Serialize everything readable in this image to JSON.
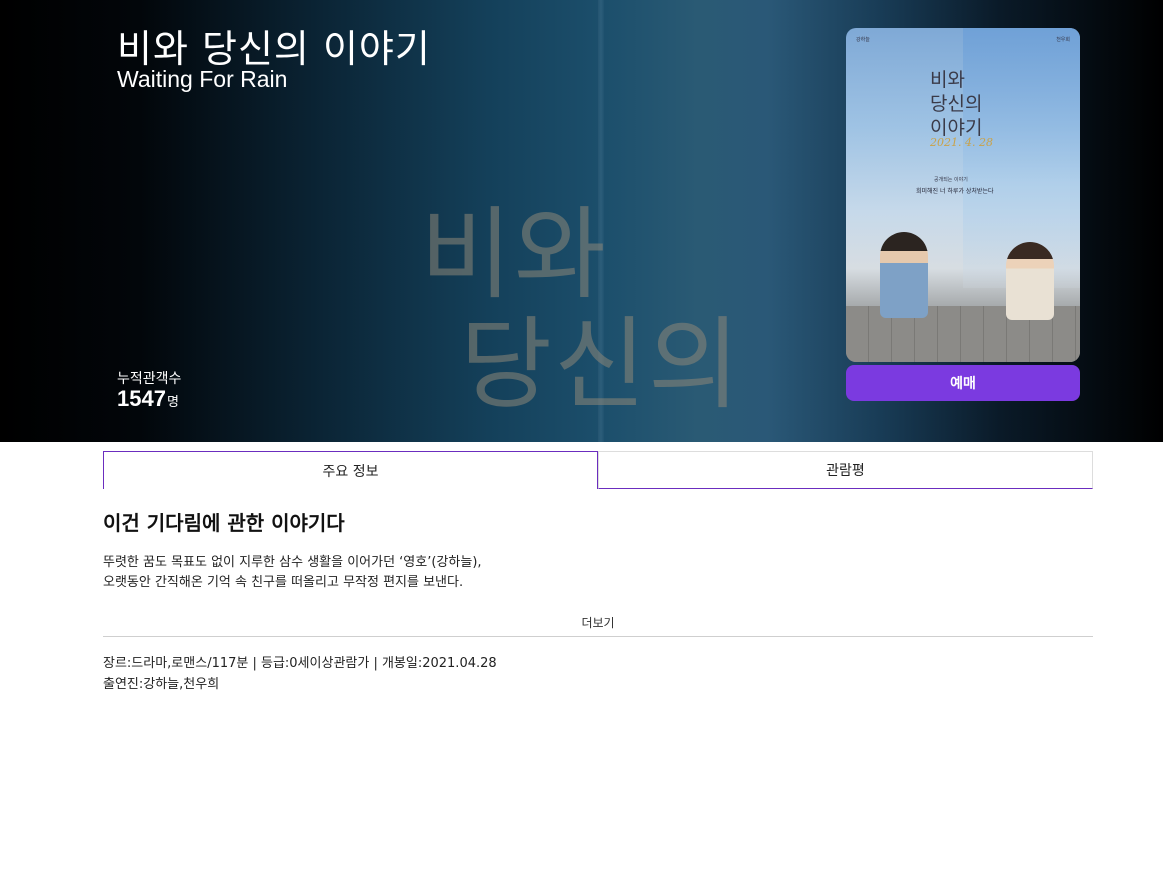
{
  "movie": {
    "title_ko": "비와 당신의 이야기",
    "title_en": "Waiting For Rain",
    "audience_label": "누적관객수",
    "audience_count": "1547",
    "audience_unit": "명"
  },
  "hero_background": {
    "calligraphy_line1": "비와",
    "calligraphy_line2": "당신의"
  },
  "poster": {
    "title_lines": [
      "비와",
      "당신의",
      "이야기"
    ],
    "date_script": "2021. 4. 28",
    "top_left": "강하늘",
    "top_right": "천우희",
    "tagline_small": "공개되는 이야기",
    "tagline": "희미해진 너 하루가 상처받는다"
  },
  "actions": {
    "reserve_label": "예매"
  },
  "tabs": [
    {
      "label": "주요 정보",
      "active": true
    },
    {
      "label": "관람평",
      "active": false
    }
  ],
  "content": {
    "headline": "이건 기다림에 관한 이야기다",
    "description_lines": [
      "뚜렷한 꿈도 목표도 없이 지루한 삼수 생활을 이어가던 ‘영호’(강하늘),",
      "오랫동안 간직해온 기억 속 친구를 떠올리고 무작정 편지를 보낸다."
    ],
    "more_label": "더보기",
    "meta_line1": "장르:드라마,로맨스/117분 | 등급:0세이상관람가 | 개봉일:2021.04.28",
    "meta_line2": "출연진:강하늘,천우희"
  },
  "colors": {
    "accent": "#7b3ae0",
    "tab_border": "#6b2dbf"
  }
}
